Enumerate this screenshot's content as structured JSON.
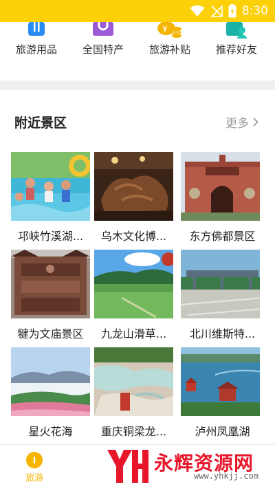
{
  "status_bar": {
    "time": "8:30",
    "background": "#fdd10a"
  },
  "quick_links": [
    {
      "label": "旅游用品",
      "icon": "luggage-icon"
    },
    {
      "label": "全国特产",
      "icon": "shopping-bag-icon"
    },
    {
      "label": "旅游补贴",
      "icon": "coin-subsidy-icon"
    },
    {
      "label": "推荐好友",
      "icon": "invite-friend-icon"
    }
  ],
  "nearby": {
    "title": "附近景区",
    "more_label": "更多",
    "spots": [
      {
        "name": "邛峡竹溪湖..."
      },
      {
        "name": "乌木文化博..."
      },
      {
        "name": "东方佛都景区"
      },
      {
        "name": "犍为文庙景区"
      },
      {
        "name": "九龙山滑草..."
      },
      {
        "name": "北川维斯特..."
      },
      {
        "name": "星火花海"
      },
      {
        "name": "重庆铜梁龙..."
      },
      {
        "name": "泸州凤凰湖"
      }
    ]
  },
  "tab_bar": {
    "active_color": "#f5b400",
    "tabs": [
      {
        "label": "旅游",
        "icon": "travel-icon",
        "active": true
      },
      {
        "label": "",
        "icon": "",
        "active": false
      },
      {
        "label": "",
        "icon": "",
        "active": false
      },
      {
        "label": "",
        "icon": "",
        "active": false
      }
    ]
  },
  "watermark": {
    "logo_text": "YH",
    "text": "永辉资源网",
    "url": "www.yhkjj.com"
  },
  "colors": {
    "accent": "#f5b400",
    "blue": "#2a8cf0",
    "purple": "#9b59d6",
    "text_muted": "#999999"
  }
}
